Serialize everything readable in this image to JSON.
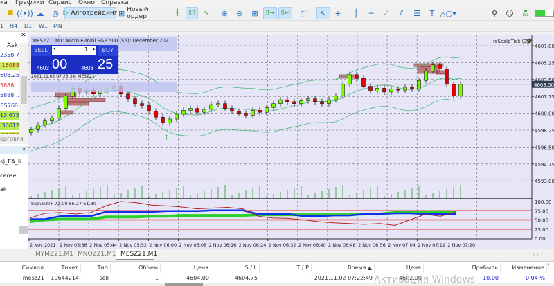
{
  "menu": [
    "ка",
    "Графики",
    "Сервис",
    "Окно",
    "Справка"
  ],
  "toolbar": {
    "algo_label": "Алготрейдинг",
    "new_order_label": "Новый ордер",
    "level_label": "LVL"
  },
  "timeframes": [
    "1",
    "H4",
    "D1",
    "W1",
    "MN"
  ],
  "market_watch": {
    "header": "Ask",
    "rows": [
      {
        "ask": "2358.7",
        "text": "#2030c0",
        "bg": "#ffffff"
      },
      {
        "ask": ".16088",
        "text": "#c02020",
        "bg": "#c8f060"
      },
      {
        "ask": "603.25",
        "text": "#2030c0",
        "bg": "#ffffff"
      },
      {
        "ask": "5888...",
        "text": "#e03030",
        "bg": "#ffffff"
      },
      {
        "ask": "5888...",
        "text": "#2030c0",
        "bg": "#ffffff"
      },
      {
        "ask": "35760",
        "text": "#2030c0",
        "bg": "#ffffff"
      },
      {
        "ask": "13.675",
        "text": "#2030c0",
        "bg": "#b8ec50"
      },
      {
        "ask": ".36612",
        "text": "#2030c0",
        "bg": "#b8ec50"
      },
      {
        "ask": ".90924",
        "text": "#d03010",
        "bg": "#b8ec50"
      }
    ],
    "tab": "орговля"
  },
  "navigator": {
    "items": [
      "s)_EA_li",
      "cense",
      "ak",
      "o",
      "e"
    ]
  },
  "chart": {
    "title": "MESZ21, M1:  Micro E-mini S&P 500 ($5): December 2021",
    "timestamp": "2021.11.02 07:23:34: MESZ21",
    "indicator_name": "rsScalpTick (2)",
    "sell_label": "SELL",
    "buy_label": "BUY",
    "volume": "1",
    "sell_price_small": "4603",
    "sell_price_big": "00",
    "buy_price_small": "4603",
    "buy_price_big": "25",
    "current_price": "4603.00",
    "price_ticks": [
      "4607.00",
      "4605.25",
      "4603.50",
      "4601.75",
      "4600.00",
      "4598.25",
      "4596.50",
      "4594.75",
      "4593.00"
    ],
    "time_ticks": [
      "2 Nov 2021",
      "2 Nov 05:36",
      "2 Nov 05:44",
      "2 Nov 05:52",
      "2 Nov 06:00",
      "2 Nov 06:08",
      "2 Nov 06:16",
      "2 Nov 06:24",
      "2 Nov 06:32",
      "2 Nov 06:40",
      "2 Nov 06:48",
      "2 Nov 06:56",
      "2 Nov 07:04",
      "2 Nov 07:12",
      "2 Nov 07:20"
    ],
    "closes": [
      4598.3,
      4598.8,
      4599.2,
      4599.5,
      4600.5,
      4601.8,
      4602.6,
      4602.2,
      4602.4,
      4602.0,
      4602.3,
      4602.5,
      4602.8,
      4602.0,
      4601.5,
      4601.0,
      4600.8,
      4600.2,
      4599.6,
      4599.0,
      4599.4,
      4599.9,
      4600.3,
      4600.5,
      4600.1,
      4600.4,
      4600.9,
      4601.0,
      4600.5,
      4600.2,
      4600.0,
      4599.8,
      4600.3,
      4600.1,
      4600.6,
      4601.0,
      4601.4,
      4601.2,
      4601.0,
      4601.3,
      4601.5,
      4601.2,
      4601.0,
      4601.4,
      4601.8,
      4603.0,
      4604.0,
      4603.6,
      4602.8,
      4602.3,
      4602.6,
      4602.2,
      4602.5,
      4602.4,
      4602.7,
      4602.5,
      4603.4,
      4604.4,
      4605.0,
      4604.6,
      4603.0,
      4601.8,
      4603.0
    ],
    "colors": {
      "bull": "#7cfc00",
      "bear": "#e00000",
      "band": "#3cb371",
      "bg": "#e6e6f6",
      "zone": "#b8bcf0"
    },
    "signal": {
      "label": "Signal3TF 72.00 66.27 61.80",
      "ticks": [
        "100.00",
        "75.00",
        "50.00",
        "25.00",
        "0.00"
      ],
      "levels": [
        75,
        50,
        25
      ],
      "red": [
        55,
        68,
        70,
        66,
        70,
        88,
        100,
        97,
        90,
        88,
        85,
        80,
        82,
        84,
        80,
        60,
        55,
        54,
        50,
        45,
        42,
        40,
        38,
        40,
        35,
        50,
        65,
        60,
        72
      ],
      "blue": [
        52,
        52,
        60,
        60,
        60,
        72,
        72,
        72,
        72,
        74,
        74,
        74,
        76,
        76,
        76,
        66,
        66,
        66,
        60,
        60,
        62,
        62,
        66,
        66,
        68,
        68,
        66,
        66,
        66
      ],
      "green": [
        45,
        50,
        52,
        52,
        52,
        58,
        58,
        58,
        60,
        60,
        62,
        62,
        62,
        62,
        62,
        64,
        64,
        64,
        64,
        64,
        64,
        64,
        66,
        66,
        70,
        70,
        72,
        72,
        72
      ]
    }
  },
  "tabs": [
    "MYMZ21,M1",
    "MNQZ21,M1",
    "MESZ21,M1"
  ],
  "trades": {
    "headers": [
      "Символ",
      "Тикет",
      "Тип",
      "Объем",
      "Цена",
      "S / L",
      "T / P",
      "Время ▲",
      "Цена",
      "Прибыль",
      "Изменение"
    ],
    "rows": [
      [
        "mesz21",
        "19644214",
        "sell",
        "1",
        "4604.00",
        "4604.75",
        "",
        "2021.11.02 07:22:49",
        "4602.00",
        "10.00",
        "0.04 %"
      ]
    ]
  },
  "watermark": "Активация Windows"
}
